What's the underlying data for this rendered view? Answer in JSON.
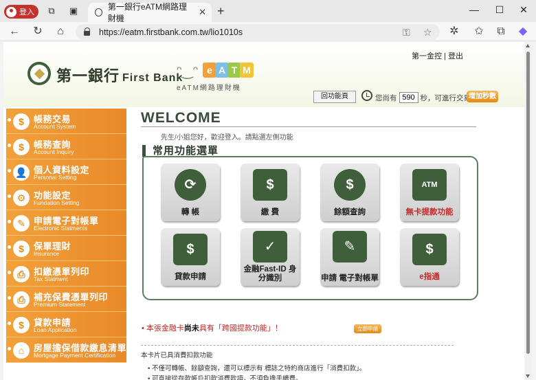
{
  "browser": {
    "profile_label": "登入",
    "tab_title": "第一銀行eATM網路理財機",
    "tab_close": "✕",
    "new_tab": "+",
    "url": "https://eatm.firstbank.com.tw/lio1010s",
    "window_controls": {
      "minimize": "—",
      "maximize": "☐",
      "close": "✕"
    }
  },
  "header": {
    "brand_zh": "第一銀行",
    "brand_en": "First Bank",
    "eatm_letters": [
      "e",
      "A",
      "T",
      "M"
    ],
    "eatm_sub": "eATM網路理財機",
    "top_links": "第一金控 | 登出",
    "back_button": "回功能頁",
    "timer_prefix": "您尚有",
    "timer_value": "590",
    "timer_suffix": "秒，可進行交易",
    "extend_button": "增加秒數"
  },
  "sidebar": {
    "items": [
      {
        "zh": "帳務交易",
        "en": "Account System",
        "icon": "dollar-icon"
      },
      {
        "zh": "帳務查詢",
        "en": "Account Inquiry",
        "icon": "inquiry-icon"
      },
      {
        "zh": "個人資料設定",
        "en": "Personal Setting",
        "icon": "person-icon"
      },
      {
        "zh": "功能設定",
        "en": "Fundation Setting",
        "icon": "gear-icon"
      },
      {
        "zh": "申請電子對帳單",
        "en": "Electronic Statments",
        "icon": "statement-icon"
      },
      {
        "zh": "保單理財",
        "en": "Insurance",
        "icon": "insurance-icon"
      },
      {
        "zh": "扣繳憑單列印",
        "en": "Tax Statment",
        "icon": "printer-icon"
      },
      {
        "zh": "補充保費憑單列印",
        "en": "Premium Statement",
        "icon": "printer-icon"
      },
      {
        "zh": "貸款申請",
        "en": "Loan Application",
        "icon": "loan-icon"
      },
      {
        "zh": "房屋擔保借款繳息清單",
        "en": "Mortgage Payment Certification",
        "icon": "house-icon"
      }
    ]
  },
  "main": {
    "welcome": "WELCOME",
    "greeting": "先生/小姐您好，歡迎登入。請點選左側功能",
    "section_title": "常用功能選單",
    "tiles": [
      {
        "label": "轉 帳",
        "icon": "transfer-icon",
        "red": false
      },
      {
        "label": "繳 費",
        "icon": "bill-payment-icon",
        "red": false
      },
      {
        "label": "餘額查詢",
        "icon": "piggy-bank-icon",
        "red": false
      },
      {
        "label": "無卡提款功能",
        "icon": "atm-icon",
        "red": true
      },
      {
        "label": "貸款申請",
        "icon": "loan-icon",
        "red": false
      },
      {
        "label": "金融Fast-ID 身分識別",
        "icon": "fast-id-icon",
        "red": false
      },
      {
        "label": "申請 電子對帳單",
        "icon": "e-statement-icon",
        "red": false
      },
      {
        "label": "e指通",
        "icon": "phone-pay-icon",
        "red": true
      }
    ],
    "notice_prefix": "• 本張金融卡",
    "notice_emph": "尚未",
    "notice_suffix": "具有「跨國提款功能」！",
    "apply_button": "立即申請",
    "sub_title": "本卡片已具消費扣款功能",
    "sub_line1": "• 不僅可轉帳、餘額查詢，還可以標示有    標誌之特約商店進行「消費扣款」。",
    "sub_line2": "• 可直接從存款帳戶扣款消費款項，不須負擔手續費。"
  }
}
